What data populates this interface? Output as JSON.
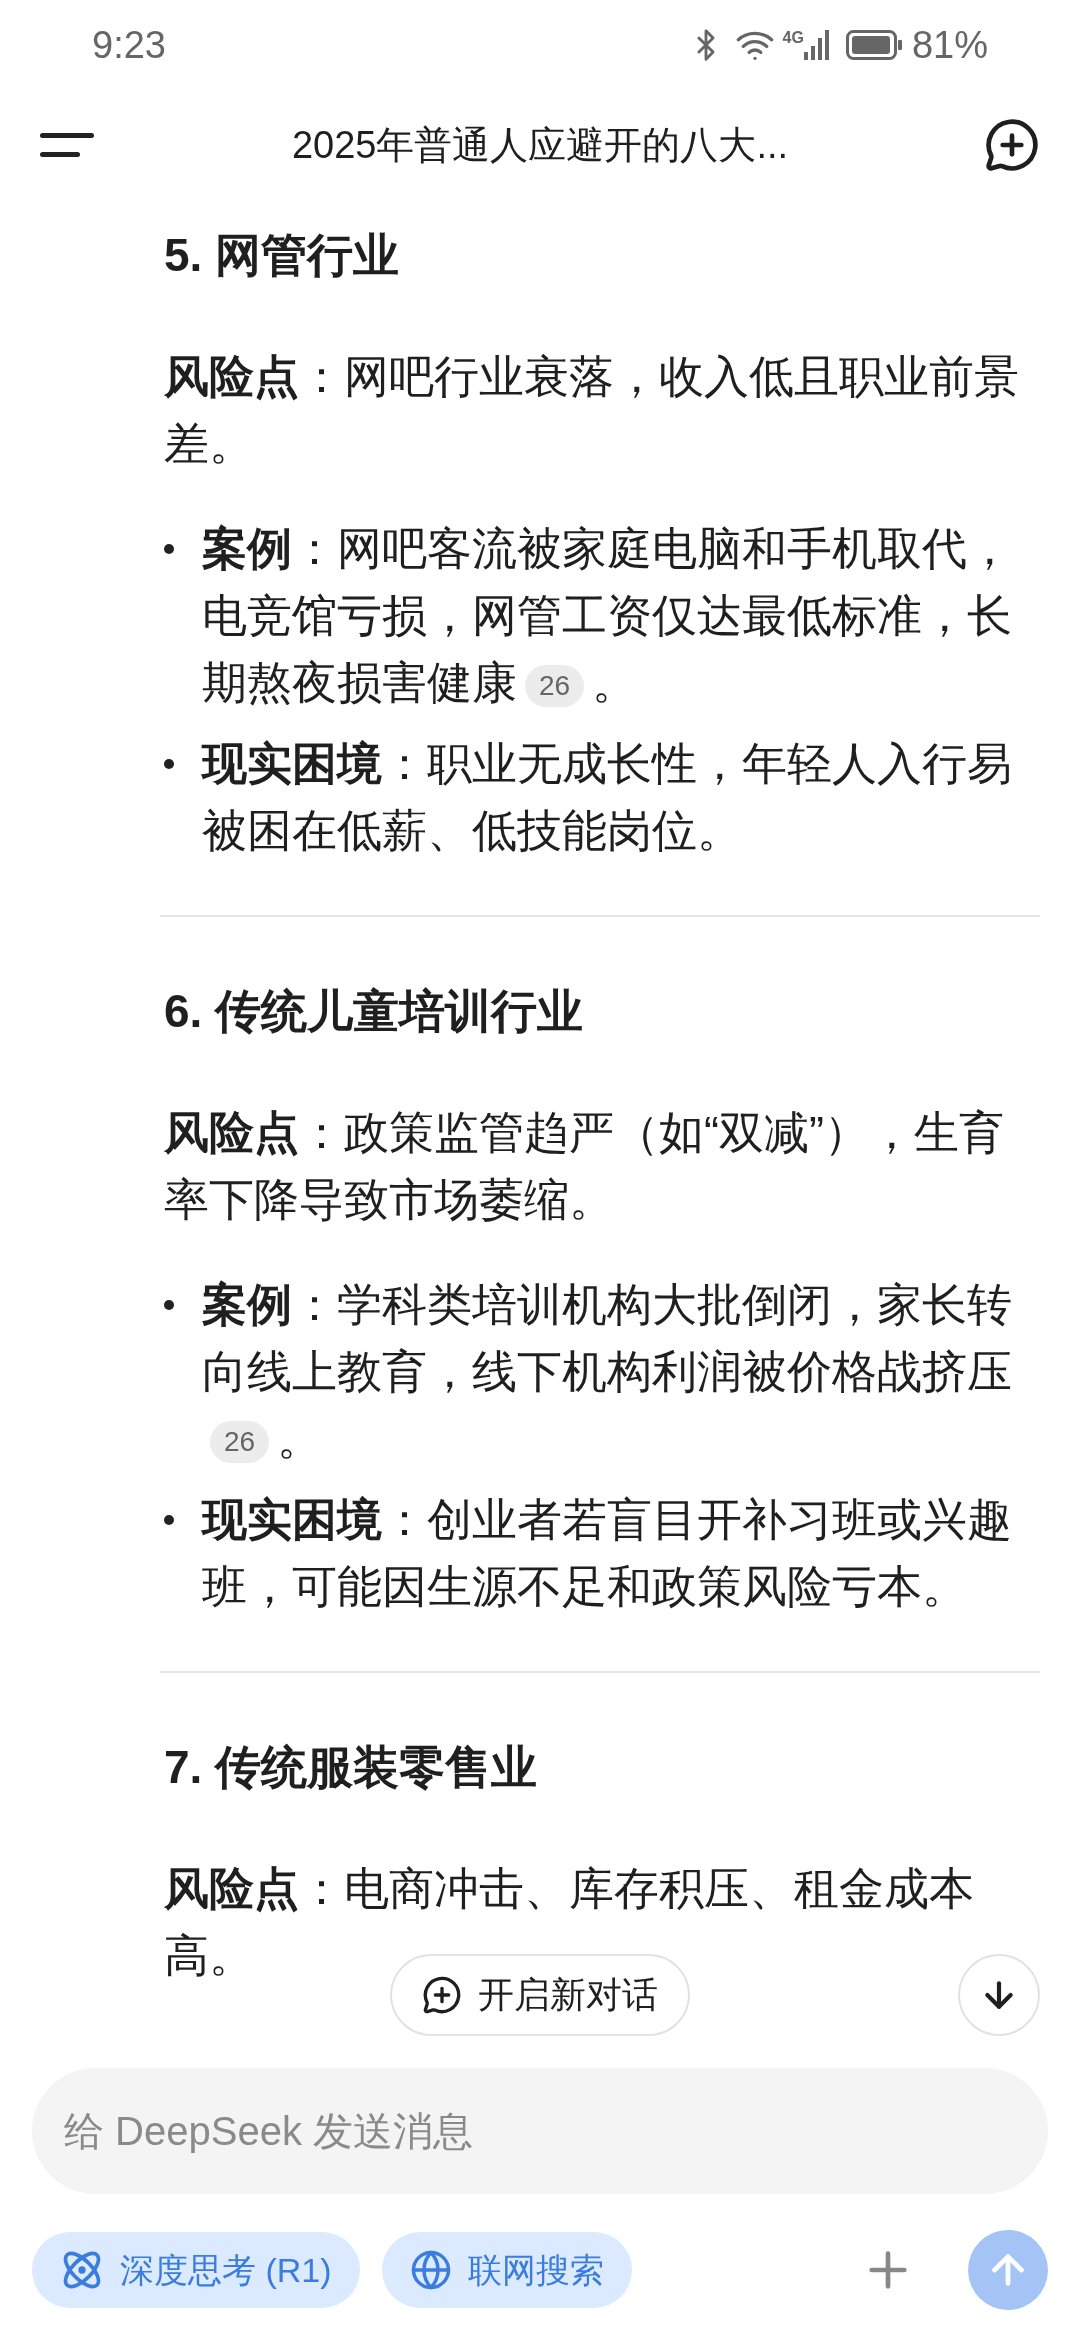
{
  "status_bar": {
    "time": "9:23",
    "network": "4G",
    "battery": "81%"
  },
  "header": {
    "title": "2025年普通人应避开的八大..."
  },
  "sections": [
    {
      "heading": "5. 网管行业",
      "risk": {
        "label": "风险点",
        "text": "：网吧行业衰落，收入低且职业前景差。"
      },
      "bullets": [
        {
          "label": "案例",
          "text": "：网吧客流被家庭电脑和手机取代，电竞馆亏损，网管工资仅达最低标准，长期熬夜损害健康",
          "citation": "26",
          "tail": "。"
        },
        {
          "label": "现实困境",
          "text": "：职业无成长性，年轻人入行易被困在低薪、低技能岗位。"
        }
      ]
    },
    {
      "heading": "6. 传统儿童培训行业",
      "risk": {
        "label": "风险点",
        "text": "：政策监管趋严（如“双减”），生育率下降导致市场萎缩。"
      },
      "bullets": [
        {
          "label": "案例",
          "text": "：学科类培训机构大批倒闭，家长转向线上教育，线下机构利润被价格战挤压",
          "citation": "26",
          "tail": "。"
        },
        {
          "label": "现实困境",
          "text": "：创业者若盲目开补习班或兴趣班，可能因生源不足和政策风险亏本。"
        }
      ]
    },
    {
      "heading": "7. 传统服装零售业",
      "risk": {
        "label": "风险点",
        "text": "：电商冲击、库存积压、租金成本高。"
      }
    }
  ],
  "new_chat_button": "开启新对话",
  "composer": {
    "placeholder": "给 DeepSeek 发送消息"
  },
  "toggles": [
    {
      "kind": "think",
      "label": "深度思考 (R1)",
      "selected": true
    },
    {
      "kind": "search",
      "label": "联网搜索",
      "selected": true
    }
  ]
}
